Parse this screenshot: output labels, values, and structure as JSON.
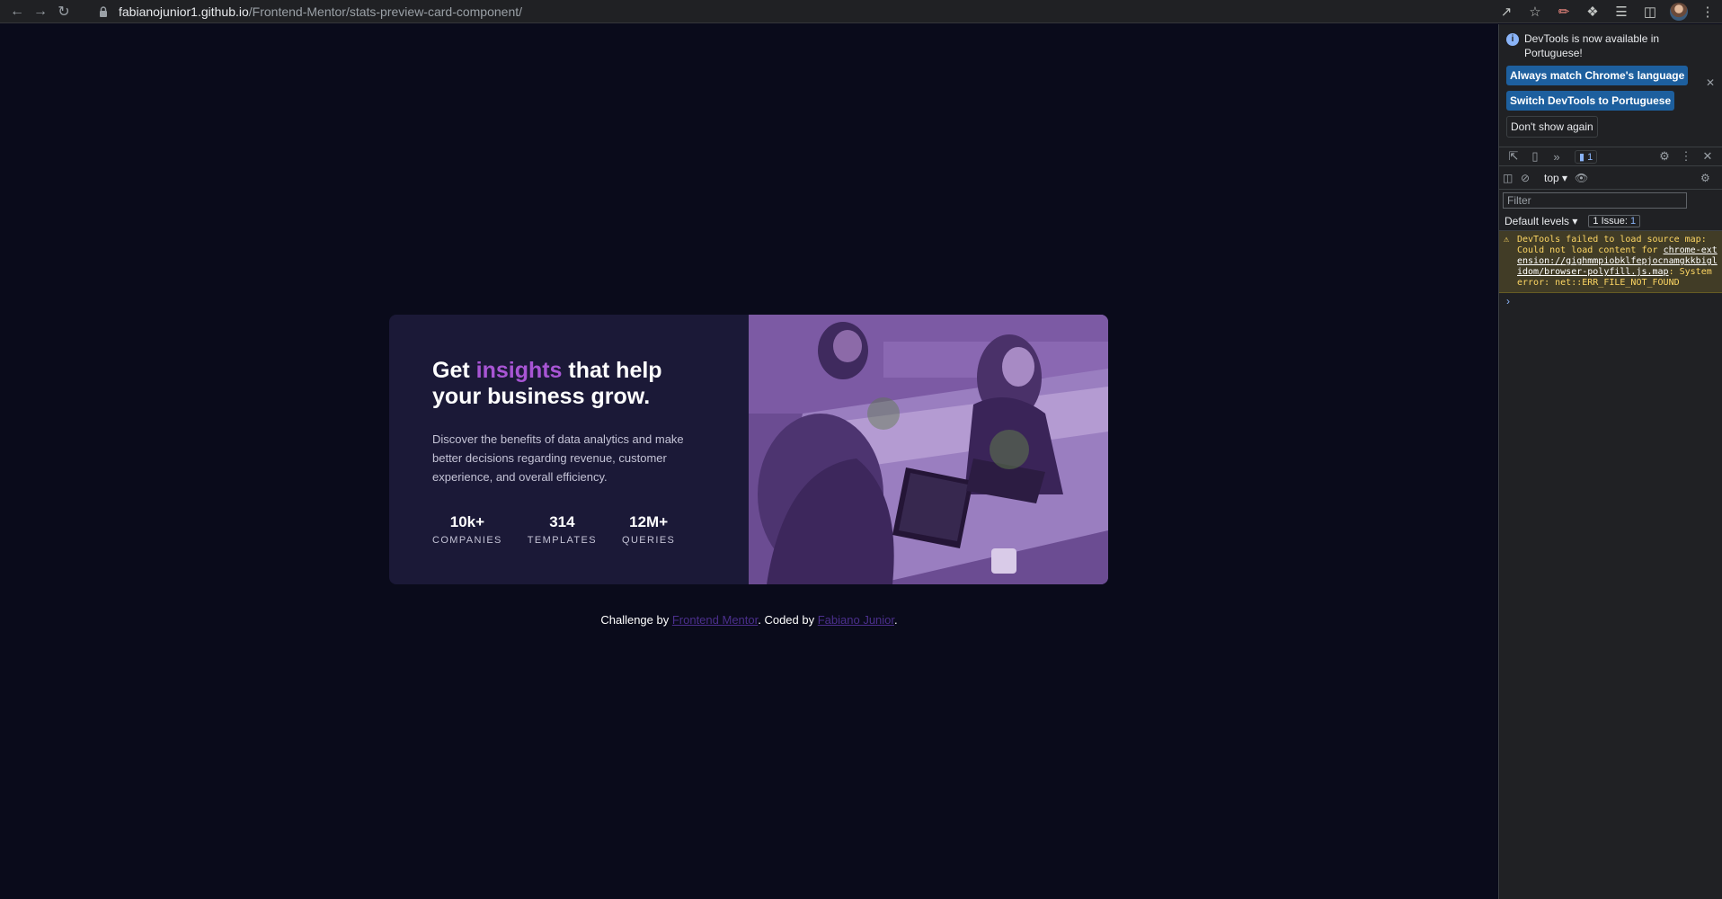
{
  "browser": {
    "url_host": "fabianojunior1.github.io",
    "url_path": "/Frontend-Mentor/stats-preview-card-component/"
  },
  "card": {
    "headline_pre": "Get ",
    "headline_accent": "insights",
    "headline_post": " that help your business grow.",
    "description": "Discover the benefits of data analytics and make better decisions regarding revenue, customer experience, and overall efficiency.",
    "stats": [
      {
        "value": "10k+",
        "label": "COMPANIES"
      },
      {
        "value": "314",
        "label": "TEMPLATES"
      },
      {
        "value": "12M+",
        "label": "QUERIES"
      }
    ]
  },
  "footer": {
    "prefix": "Challenge by ",
    "link1": "Frontend Mentor",
    "middle": ". Coded by ",
    "link2": "Fabiano Junior",
    "suffix": "."
  },
  "devtools": {
    "info_text": "DevTools is now available in Portuguese!",
    "btn_match": "Always match Chrome's language",
    "btn_switch": "Switch DevTools to Portuguese",
    "btn_dont_show": "Don't show again",
    "issues_badge": "1",
    "context": "top",
    "filter_placeholder": "Filter",
    "default_levels": "Default levels ▾",
    "issue_label": "1 Issue:",
    "issue_num": "1",
    "msg_before": "DevTools failed to load source map: Could not load content for ",
    "msg_link": "chrome-extension://gighmmpiobklfepjocnamgkkbiglidom/browser-polyfill.js.map",
    "msg_after": ": System error: net::ERR_FILE_NOT_FOUND"
  },
  "colors": {
    "page_bg": "#0a0b1b",
    "card_bg": "#1b1937",
    "accent": "#a855d4",
    "image_tint": "#6b4c92"
  }
}
